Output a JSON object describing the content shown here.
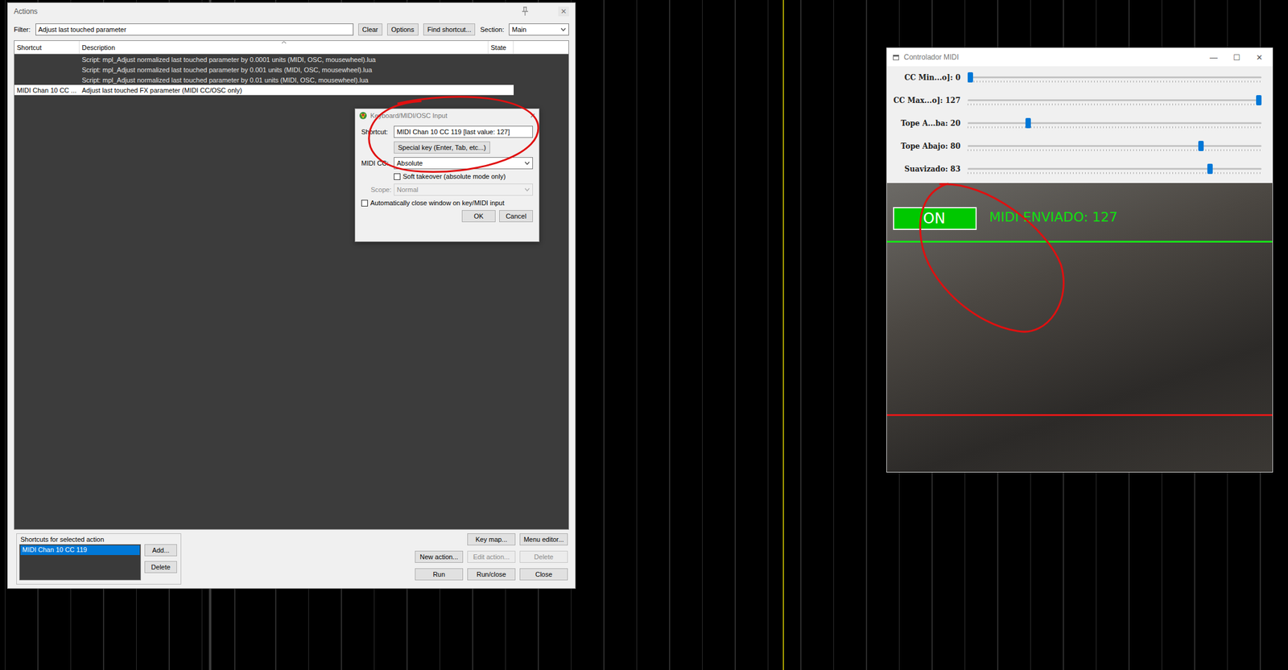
{
  "actions_window": {
    "title": "Actions",
    "close_glyph": "✕",
    "filter": {
      "label": "Filter:",
      "value": "Adjust last touched parameter"
    },
    "filter_buttons": [
      "Clear",
      "Options",
      "Find shortcut..."
    ],
    "section": {
      "label": "Section:",
      "value": "Main"
    },
    "table": {
      "columns": [
        "Shortcut",
        "Description",
        "State"
      ],
      "rows": [
        {
          "shortcut": "",
          "description": "Script: mpl_Adjust normalized last touched parameter by 0.0001 units (MIDI, OSC, mousewheel).lua",
          "state": "",
          "selected": false
        },
        {
          "shortcut": "",
          "description": "Script: mpl_Adjust normalized last touched parameter by 0.001 units (MIDI, OSC, mousewheel).lua",
          "state": "",
          "selected": false
        },
        {
          "shortcut": "",
          "description": "Script: mpl_Adjust normalized last touched parameter by 0.01 units (MIDI, OSC, mousewheel).lua",
          "state": "",
          "selected": false
        },
        {
          "shortcut": "MIDI Chan 10 CC ...",
          "description": "Adjust last touched FX parameter (MIDI CC/OSC only)",
          "state": "",
          "selected": true
        }
      ]
    },
    "shortcuts_group": {
      "title": "Shortcuts for selected action",
      "items": [
        {
          "label": "MIDI Chan 10 CC 119",
          "selected": true
        }
      ],
      "buttons": [
        "Add...",
        "Delete"
      ]
    },
    "buttons": [
      {
        "label": "Key map...",
        "disabled": false
      },
      {
        "label": "Menu editor...",
        "disabled": false
      },
      {
        "label": "New action...",
        "disabled": false
      },
      {
        "label": "Edit action...",
        "disabled": true
      },
      {
        "label": "Delete",
        "disabled": true
      },
      {
        "label": "Run",
        "disabled": false
      },
      {
        "label": "Run/close",
        "disabled": false
      },
      {
        "label": "Close",
        "disabled": false
      }
    ]
  },
  "input_dialog": {
    "title": "Keyboard/MIDI/OSC Input",
    "close_glyph": "✕",
    "shortcut": {
      "label": "Shortcut:",
      "value": "MIDI Chan 10 CC 119 [last value: 127]"
    },
    "special_key_button": "Special key (Enter, Tab, etc...)",
    "midi_cc": {
      "label": "MIDI CC:",
      "value": "Absolute"
    },
    "soft_takeover": {
      "label": "Soft takeover (absolute mode only)",
      "checked": false
    },
    "scope": {
      "label": "Scope:",
      "value": "Normal",
      "disabled": true
    },
    "auto_close": {
      "label": "Automatically close window on key/MIDI input",
      "checked": false
    },
    "buttons": [
      "OK",
      "Cancel"
    ]
  },
  "midi_window": {
    "title": "Controlador MIDI",
    "window_buttons": [
      "—",
      "☐",
      "✕"
    ],
    "sliders": [
      {
        "label": "CC Min...o]: 0",
        "level": 0
      },
      {
        "label": "CC Max...o]: 127",
        "level": 1
      },
      {
        "label": "Tope A...ba: 20",
        "level": 0.2
      },
      {
        "label": "Tope Abajo: 80",
        "level": 0.8
      },
      {
        "label": "Suavizado: 83",
        "level": 0.83
      }
    ],
    "video": {
      "status": "ON",
      "message": "MIDI ENVIADO: 127"
    }
  }
}
